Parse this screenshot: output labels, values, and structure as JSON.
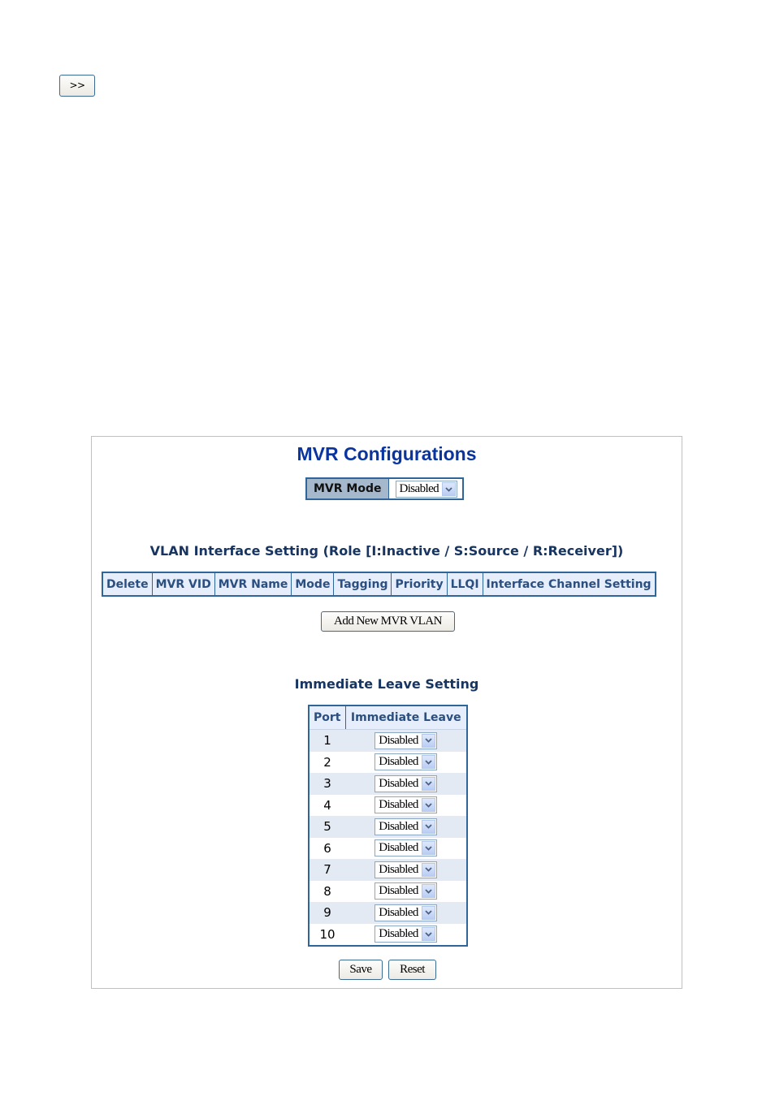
{
  "nav": {
    "button_label": ">>"
  },
  "panel": {
    "title": "MVR Configurations",
    "mvr_mode": {
      "label": "MVR Mode",
      "value": "Disabled"
    },
    "vlan_section": {
      "title": "VLAN Interface Setting (Role [I:Inactive / S:Source / R:Receiver])",
      "columns": [
        "Delete",
        "MVR VID",
        "MVR Name",
        "Mode",
        "Tagging",
        "Priority",
        "LLQI",
        "Interface Channel Setting"
      ],
      "add_button_label": "Add New MVR VLAN"
    },
    "immediate_leave": {
      "title": "Immediate Leave Setting",
      "columns": [
        "Port",
        "Immediate Leave"
      ],
      "rows": [
        {
          "port": "1",
          "value": "Disabled"
        },
        {
          "port": "2",
          "value": "Disabled"
        },
        {
          "port": "3",
          "value": "Disabled"
        },
        {
          "port": "4",
          "value": "Disabled"
        },
        {
          "port": "5",
          "value": "Disabled"
        },
        {
          "port": "6",
          "value": "Disabled"
        },
        {
          "port": "7",
          "value": "Disabled"
        },
        {
          "port": "8",
          "value": "Disabled"
        },
        {
          "port": "9",
          "value": "Disabled"
        },
        {
          "port": "10",
          "value": "Disabled"
        }
      ]
    },
    "save_label": "Save",
    "reset_label": "Reset"
  },
  "icons": {
    "dropdown": "chevron-down-icon"
  },
  "colors": {
    "title": "#0a35a0",
    "table_border": "#2f6598",
    "header_bg": "#e6eefb",
    "mode_label_bg": "#a6b9cc"
  }
}
